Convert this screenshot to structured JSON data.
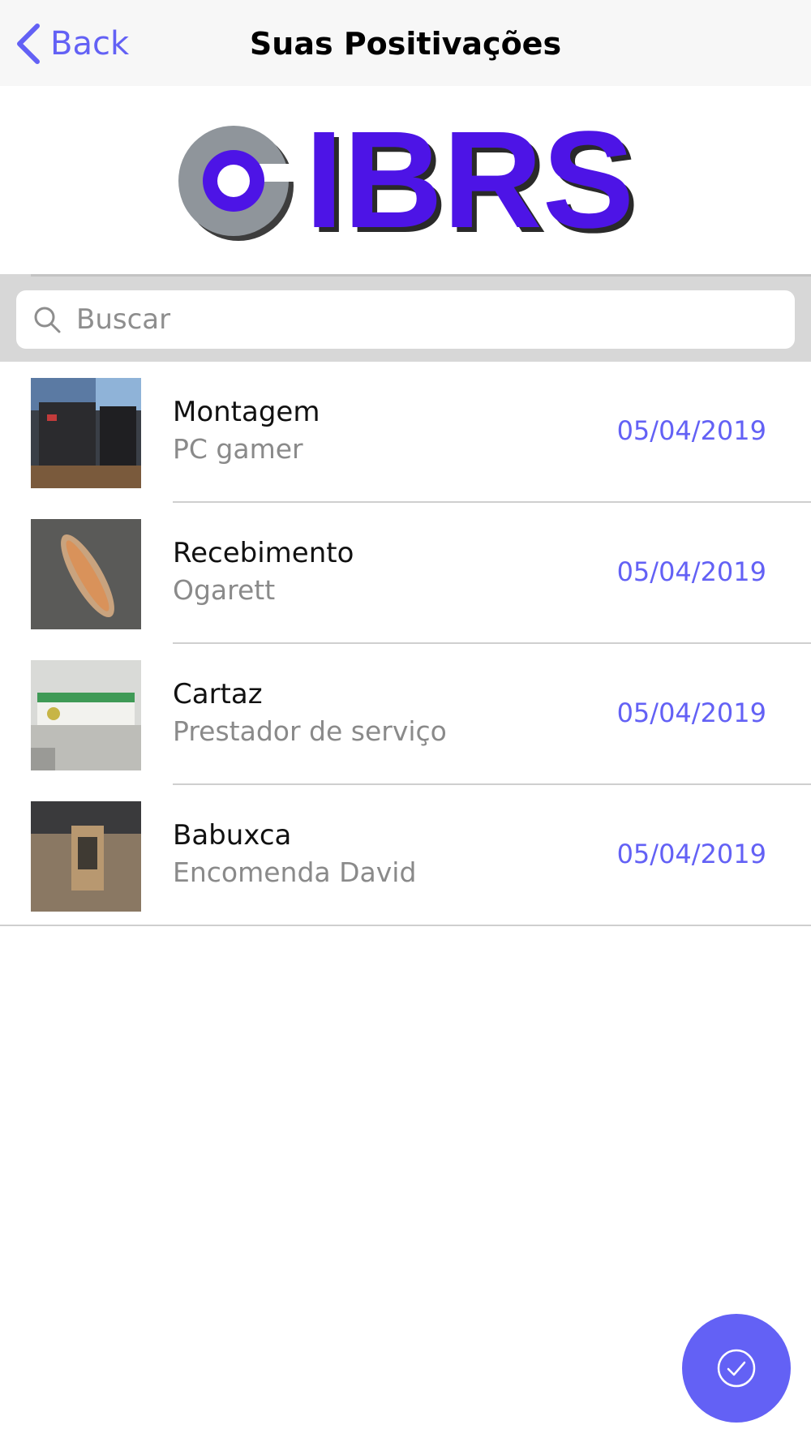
{
  "navbar": {
    "back_label": "Back",
    "title": "Suas Positivações"
  },
  "logo": {
    "text": "IBRS",
    "brand_color": "#4d14e6"
  },
  "search": {
    "placeholder": "Buscar",
    "value": ""
  },
  "items": [
    {
      "title": "Montagem",
      "subtitle": "PC gamer",
      "date": "05/04/2019",
      "thumb_icon": "pc-photo"
    },
    {
      "title": "Recebimento",
      "subtitle": "Ogarett",
      "date": "05/04/2019",
      "thumb_icon": "package-photo"
    },
    {
      "title": "Cartaz",
      "subtitle": "Prestador de serviço",
      "date": "05/04/2019",
      "thumb_icon": "poster-photo"
    },
    {
      "title": "Babuxca",
      "subtitle": "Encomenda David",
      "date": "05/04/2019",
      "thumb_icon": "bag-photo"
    }
  ],
  "fab": {
    "icon": "check-circle-icon"
  },
  "colors": {
    "accent": "#6361f5",
    "navbar_bg": "#f7f7f7",
    "search_band": "#d7d7d7"
  }
}
